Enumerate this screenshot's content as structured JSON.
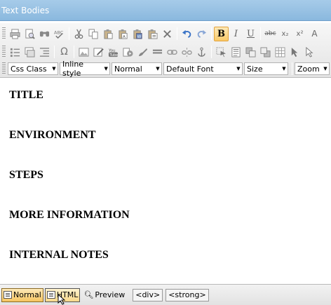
{
  "window": {
    "title": "Text Bodies"
  },
  "toolbar": {
    "row1": [
      "print-icon",
      "preview-icon",
      "find-icon",
      "spellcheck-icon",
      "cut-icon",
      "copy-icon",
      "paste-icon",
      "paste-text-icon",
      "paste-word-icon",
      "paste-html-icon",
      "delete-icon",
      "undo-icon",
      "redo-icon",
      "bold-icon",
      "italic-icon",
      "underline-icon",
      "strikethrough-icon",
      "subscript-icon",
      "superscript-icon",
      "font-size-icon"
    ],
    "row2": [
      "list-icon",
      "form-icon",
      "indent-icon",
      "symbol-icon",
      "image-icon",
      "edit-image-icon",
      "youtube-icon",
      "media-icon",
      "style-icon",
      "horizontal-rule-icon",
      "link-icon",
      "unlink-icon",
      "anchor-icon",
      "select-icon",
      "template-icon",
      "layer-icon",
      "layer-front-icon",
      "table-icon",
      "pointer-icon",
      "pointer-alt-icon"
    ],
    "glyphs": {
      "bold": "B",
      "italic": "I",
      "underline": "U",
      "strike": "abc",
      "sub": "x₂",
      "sup": "x²",
      "font_size": "A",
      "symbol": "Ω"
    },
    "dropdowns": {
      "css_class": "Css Class",
      "inline_style": "Inline style",
      "paragraph": "Normal",
      "font": "Default Font",
      "size": "Size",
      "zoom": "Zoom"
    },
    "bold_active": true
  },
  "content": {
    "headings": [
      "TITLE",
      "ENVIRONMENT",
      "STEPS",
      "MORE INFORMATION",
      "INTERNAL NOTES"
    ]
  },
  "bottombar": {
    "modes": {
      "normal": "Normal",
      "html": "HTML",
      "preview": "Preview"
    },
    "selected_mode": "normal",
    "tag_path": [
      "<div>",
      "<strong>"
    ]
  },
  "colors": {
    "titlebar": "#8ab8de",
    "active_button": "#f9c968",
    "background": "#ffffff"
  }
}
